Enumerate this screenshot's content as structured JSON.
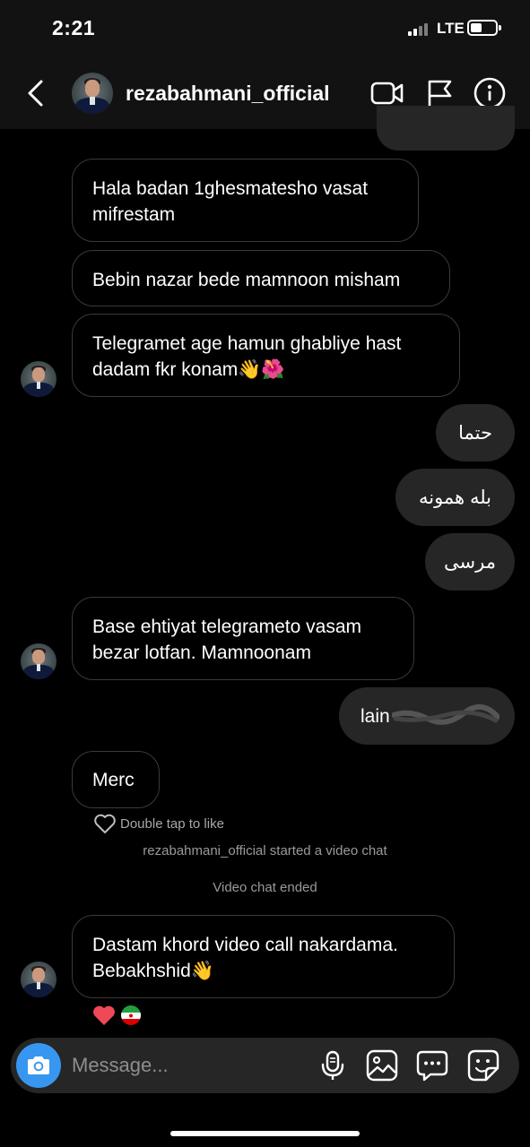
{
  "status_bar": {
    "time": "2:21",
    "network": "LTE"
  },
  "header": {
    "username": "rezabahmani_official",
    "icons": [
      "back-chevron-icon",
      "video-camera-icon",
      "flag-icon",
      "info-icon"
    ]
  },
  "messages": [
    {
      "direction": "in",
      "text": "Hala badan 1ghesmatesho vasat\nmifrestam"
    },
    {
      "direction": "in",
      "text": "Bebin nazar bede mamnoon misham"
    },
    {
      "direction": "in",
      "text": "Telegramet age hamun ghabliye hast\ndadam fkr konam👋🌺"
    },
    {
      "direction": "out",
      "text": "حتما"
    },
    {
      "direction": "out",
      "text": "بله همونه"
    },
    {
      "direction": "out",
      "text": "مرسی"
    },
    {
      "direction": "in",
      "text": "Base ehtiyat telegrameto vasam\nbezar lotfan. Mamnoonam"
    },
    {
      "direction": "out",
      "text": "lain"
    },
    {
      "direction": "in",
      "text": "Merc"
    },
    {
      "direction": "in",
      "text": "Dastam khord video call nakardama.\nBebakhshid👋"
    }
  ],
  "double_tap_hint": "Double tap to like",
  "system_events": {
    "video_started": "rezabahmani_official started a video chat",
    "video_ended": "Video chat ended"
  },
  "reactions": [
    "❤️",
    "🇮🇷"
  ],
  "composer": {
    "placeholder": "Message...",
    "icons": [
      "camera-icon",
      "microphone-icon",
      "gallery-icon",
      "chat-bubble-icon",
      "sticker-icon"
    ]
  },
  "colors": {
    "background": "#000000",
    "bar": "#121212",
    "outgoing_bubble": "#262626",
    "camera_button": "#3797f0"
  }
}
